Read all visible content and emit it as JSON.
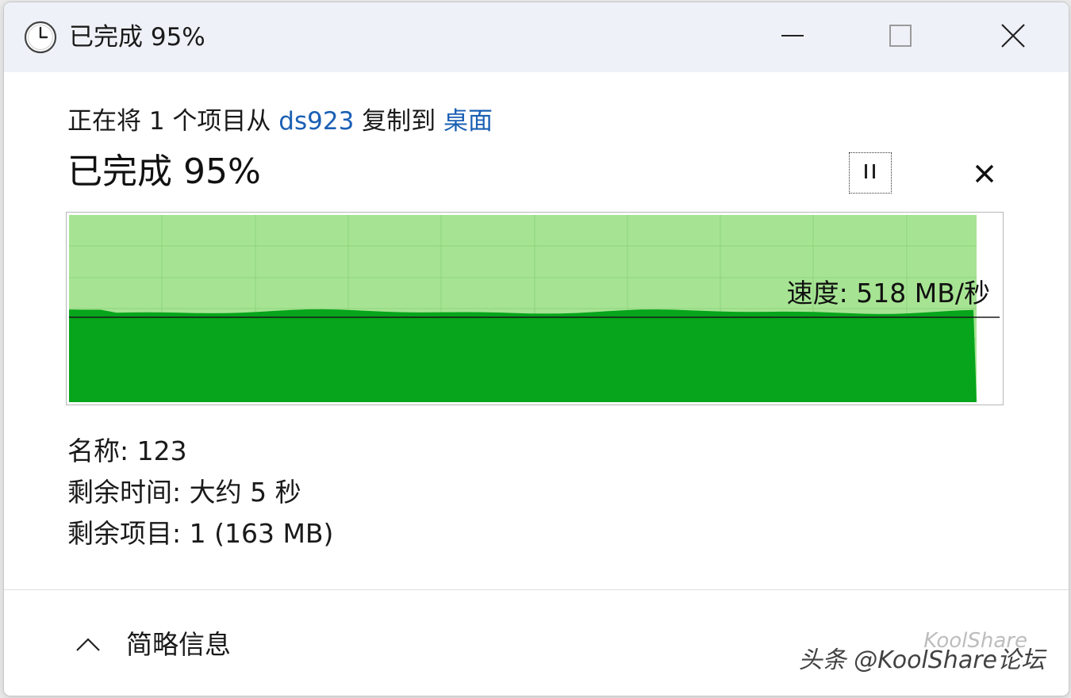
{
  "window": {
    "title": "已完成 95%",
    "icon": "clock-icon",
    "controls": [
      "minimize-icon",
      "maximize-icon",
      "close-icon"
    ]
  },
  "copy_status": {
    "prefix": "正在将 1 个项目从 ",
    "source": "ds923",
    "middle": " 复制到 ",
    "destination": "桌面",
    "percent_text": "已完成 95%",
    "percent_complete": 95
  },
  "buttons": {
    "pause_icon": "pause-icon",
    "cancel_icon": "x-icon"
  },
  "graph": {
    "speed_text": "速度: 518 MB/秒",
    "speed_mb_per_s": 518,
    "progress_fraction": 0.975,
    "colors": {
      "done_fill": "#06a51b",
      "remaining_fill": "#a6e493",
      "grid": "#8fd37c"
    }
  },
  "details": {
    "name_line": "名称: 123",
    "time_left_line": "剩余时间: 大约 5 秒",
    "items_left_line": "剩余项目: 1 (163 MB)"
  },
  "footer": {
    "toggle_label": "简略信息",
    "toggle_icon": "chevron-up-icon"
  },
  "watermark": {
    "main": "头条 @KoolShare论坛",
    "ghost": "KoolShare"
  }
}
